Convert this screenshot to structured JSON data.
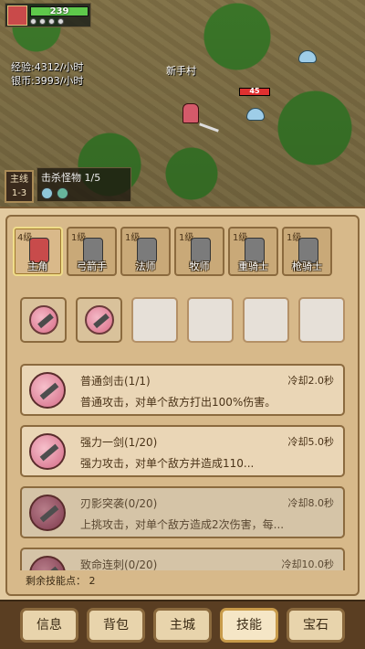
{
  "hud": {
    "hp": "239"
  },
  "rates": {
    "exp": "经验:4312/小时",
    "silver": "银币:3993/小时"
  },
  "map": {
    "village": "新手村",
    "enemy_hp": "45"
  },
  "stage": {
    "label": "主线",
    "value": "1-3"
  },
  "quest": {
    "text": "击杀怪物",
    "progress": "1/5"
  },
  "heroes": [
    {
      "level": "4级",
      "name": "主角",
      "active": true
    },
    {
      "level": "1级",
      "name": "弓箭手",
      "active": false
    },
    {
      "level": "1级",
      "name": "法师",
      "active": false
    },
    {
      "level": "1级",
      "name": "牧师",
      "active": false
    },
    {
      "level": "1级",
      "name": "重骑士",
      "active": false
    },
    {
      "level": "1级",
      "name": "枪骑士",
      "active": false
    }
  ],
  "skills": [
    {
      "title": "普通剑击(1/1)",
      "cooldown": "冷却2.0秒",
      "desc": "普通攻击，对单个敌方打出100%伤害。"
    },
    {
      "title": "强力一剑(1/20)",
      "cooldown": "冷却5.0秒",
      "desc": "强力攻击，对单个敌方并造成110..."
    },
    {
      "title": "刃影突袭(0/20)",
      "cooldown": "冷却8.0秒",
      "desc": "上挑攻击，对单个敌方造成2次伤害，每..."
    },
    {
      "title": "致命连刺(0/20)",
      "cooldown": "冷却10.0秒",
      "desc": ""
    }
  ],
  "points": "剩余技能点： 2",
  "nav": {
    "info": "信息",
    "bag": "背包",
    "city": "主城",
    "skills": "技能",
    "gems": "宝石"
  }
}
